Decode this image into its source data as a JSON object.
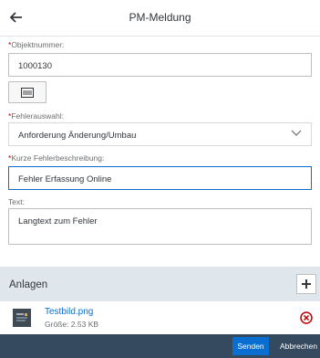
{
  "header": {
    "title": "PM-Meldung",
    "back_icon": "arrow-left-icon"
  },
  "form": {
    "objektnummer": {
      "required_mark": "*",
      "label": "Objektnummer:",
      "value": "1000130"
    },
    "scan_icon": "barcode-scan-icon",
    "fehlerauswahl": {
      "required_mark": "*",
      "label": "Fehlerauswahl:",
      "value": "Anforderung Änderung/Umbau"
    },
    "kurzbeschreibung": {
      "required_mark": "*",
      "label": "Kurze Fehlerbeschreibung:",
      "value": "Fehler Erfassung Online"
    },
    "text": {
      "label": "Text:",
      "value": "Langtext zum Fehler"
    }
  },
  "attachments": {
    "title": "Anlagen",
    "items": [
      {
        "name": "Testbild.png",
        "size": "Größe: 2.53 KB"
      }
    ]
  },
  "footer": {
    "send_label": "Senden",
    "cancel_label": "Abbrechen"
  },
  "colors": {
    "accent": "#0a6ed1",
    "footer_bg": "#354a5f",
    "section_bg": "#dfe6ec",
    "error": "#bb0000"
  }
}
